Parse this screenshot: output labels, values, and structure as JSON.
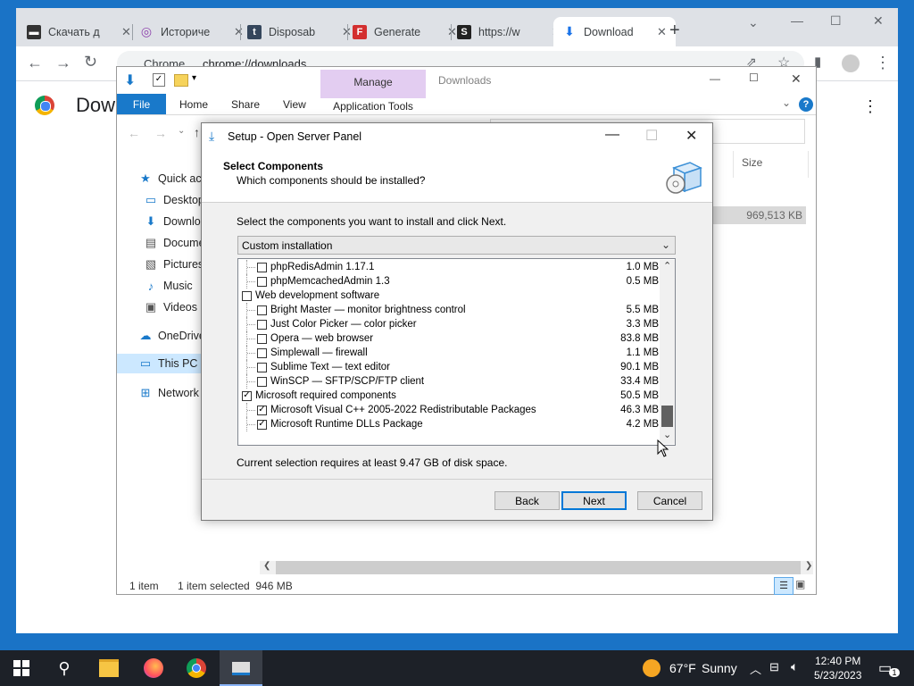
{
  "chrome": {
    "tabs": [
      {
        "title": "Скачать д",
        "icon": "terminal-icon"
      },
      {
        "title": "Историче",
        "icon": "podcast-icon"
      },
      {
        "title": "Disposab",
        "icon": "tumblr-icon"
      },
      {
        "title": "Generate",
        "icon": "f-icon"
      },
      {
        "title": "https://w",
        "icon": "s-icon"
      },
      {
        "title": "Download",
        "icon": "download-icon"
      }
    ],
    "new_tab_label": "+",
    "omnibox_site": "Chrome",
    "omnibox_url": "chrome://downloads",
    "page_title": "Dow"
  },
  "explorer": {
    "window_title": "Downloads",
    "ribbon": {
      "file": "File",
      "home": "Home",
      "share": "Share",
      "view": "View",
      "manage": "Manage",
      "app_tools": "Application Tools"
    },
    "sidebar": [
      {
        "label": "Quick acc",
        "icon": "star-icon"
      },
      {
        "label": "Desktop",
        "icon": "desktop-icon"
      },
      {
        "label": "Downlo",
        "icon": "download-arrow-icon"
      },
      {
        "label": "Docume",
        "icon": "document-icon"
      },
      {
        "label": "Pictures",
        "icon": "pictures-icon"
      },
      {
        "label": "Music",
        "icon": "music-icon"
      },
      {
        "label": "Videos",
        "icon": "videos-icon"
      },
      {
        "label": "OneDrive",
        "icon": "cloud-icon"
      },
      {
        "label": "This PC",
        "icon": "pc-icon"
      },
      {
        "label": "Network",
        "icon": "network-icon"
      }
    ],
    "column_size": "Size",
    "file_size": "969,513 KB",
    "status": {
      "items": "1 item",
      "selected": "1 item selected  946 MB"
    }
  },
  "dialog": {
    "title": "Setup - Open Server Panel",
    "heading": "Select Components",
    "subheading": "Which components should be installed?",
    "instruction": "Select the components you want to install and click Next.",
    "install_type": "Custom installation",
    "components": [
      {
        "label": "phpRedisAdmin 1.17.1",
        "size": "1.0 MB",
        "checked": false,
        "level": 1
      },
      {
        "label": "phpMemcachedAdmin 1.3",
        "size": "0.5 MB",
        "checked": false,
        "level": 1
      },
      {
        "label": "Web development software",
        "size": "",
        "checked": false,
        "level": 0
      },
      {
        "label": "Bright Master — monitor brightness control",
        "size": "5.5 MB",
        "checked": false,
        "level": 1
      },
      {
        "label": "Just Color Picker — color picker",
        "size": "3.3 MB",
        "checked": false,
        "level": 1
      },
      {
        "label": "Opera — web browser",
        "size": "83.8 MB",
        "checked": false,
        "level": 1
      },
      {
        "label": "Simplewall — firewall",
        "size": "1.1 MB",
        "checked": false,
        "level": 1
      },
      {
        "label": "Sublime Text — text editor",
        "size": "90.1 MB",
        "checked": false,
        "level": 1
      },
      {
        "label": "WinSCP — SFTP/SCP/FTP client",
        "size": "33.4 MB",
        "checked": false,
        "level": 1
      },
      {
        "label": "Microsoft required components",
        "size": "50.5 MB",
        "checked": true,
        "level": 0
      },
      {
        "label": "Microsoft Visual C++ 2005-2022 Redistributable Packages",
        "size": "46.3 MB",
        "checked": true,
        "level": 1
      },
      {
        "label": "Microsoft Runtime DLLs Package",
        "size": "4.2 MB",
        "checked": true,
        "level": 1
      }
    ],
    "disk_space": "Current selection requires at least 9.47 GB of disk space.",
    "buttons": {
      "back": "Back",
      "next": "Next",
      "cancel": "Cancel"
    }
  },
  "taskbar": {
    "weather_temp": "67°F",
    "weather_desc": "Sunny",
    "time": "12:40 PM",
    "date": "5/23/2023",
    "notification_count": "1"
  }
}
